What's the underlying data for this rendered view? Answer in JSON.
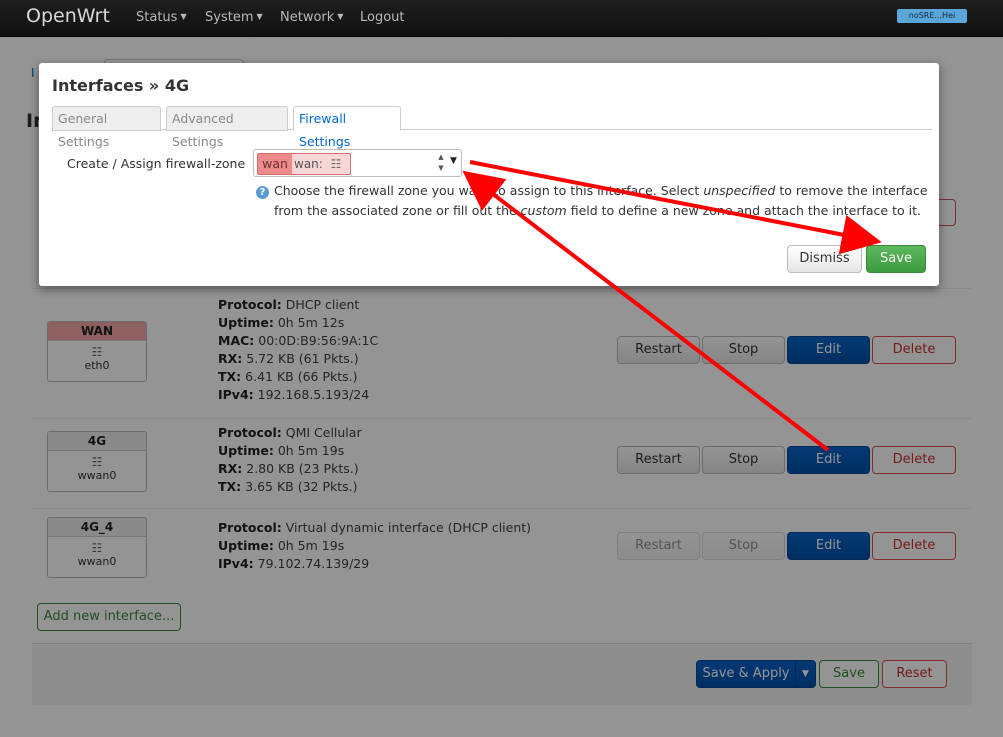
{
  "navbar": {
    "brand": "OpenWrt",
    "menu": [
      {
        "label": "Status",
        "caret": "▼"
      },
      {
        "label": "System",
        "caret": "▼"
      },
      {
        "label": "Network",
        "caret": "▼"
      },
      {
        "label": "Logout",
        "caret": ""
      }
    ],
    "host_badge": "noSRE...Hei"
  },
  "background": {
    "tab_peek": "I",
    "heading_peek": "In",
    "interfaces": [
      {
        "name": "WAN",
        "device": "eth0",
        "info": [
          {
            "key": "Protocol:",
            "value": " DHCP client"
          },
          {
            "key": "Uptime:",
            "value": " 0h 5m 12s"
          },
          {
            "key": "MAC:",
            "value": " 00:0D:B9:56:9A:1C"
          },
          {
            "key": "RX:",
            "value": " 5.72 KB (61 Pkts.)"
          },
          {
            "key": "TX:",
            "value": " 6.41 KB (66 Pkts.)"
          },
          {
            "key": "IPv4:",
            "value": " 192.168.5.193/24"
          }
        ]
      },
      {
        "name": "4G",
        "device": "wwan0",
        "info": [
          {
            "key": "Protocol:",
            "value": " QMI Cellular"
          },
          {
            "key": "Uptime:",
            "value": " 0h 5m 19s"
          },
          {
            "key": "RX:",
            "value": " 2.80 KB (23 Pkts.)"
          },
          {
            "key": "TX:",
            "value": " 3.65 KB (32 Pkts.)"
          }
        ]
      },
      {
        "name": "4G_4",
        "device": "wwan0",
        "info": [
          {
            "key": "Protocol:",
            "value": " Virtual dynamic interface (DHCP client)"
          },
          {
            "key": "Uptime:",
            "value": " 0h 5m 19s"
          },
          {
            "key": "IPv4:",
            "value": " 79.102.74.139/29"
          }
        ]
      }
    ],
    "row_buttons": {
      "restart": "Restart",
      "stop": "Stop",
      "edit": "Edit",
      "delete": "Delete"
    },
    "add_interface": "Add new interface...",
    "footer": {
      "save_apply": "Save & Apply",
      "save_apply_caret": "▼",
      "save": "Save",
      "reset": "Reset"
    }
  },
  "modal": {
    "title": "Interfaces » 4G",
    "tabs": [
      {
        "label": "General Settings",
        "active": false
      },
      {
        "label": "Advanced Settings",
        "active": false
      },
      {
        "label": "Firewall Settings",
        "active": true
      }
    ],
    "field": {
      "label": "Create / Assign firewall-zone",
      "zone_name": "wan",
      "zone_member": "wan:",
      "spin_up": "▲",
      "spin_down": "▼",
      "dropdown_arrow": "▼"
    },
    "help": {
      "icon": "?",
      "parts": [
        {
          "text": "Choose the firewall zone you want to assign to this interface. Select ",
          "style": "normal"
        },
        {
          "text": "unspecified",
          "style": "italic"
        },
        {
          "text": " to remove the interface from the associated zone or fill out the ",
          "style": "normal"
        },
        {
          "text": "custom",
          "style": "italic"
        },
        {
          "text": " field to define a new zone and attach the interface to it.",
          "style": "normal"
        }
      ]
    },
    "buttons": {
      "dismiss": "Dismiss",
      "save": "Save"
    }
  },
  "colors": {
    "arrow": "#ff0000",
    "wan_zone": "#f08a8a",
    "primary": "#0050a8",
    "success": "#4cae4c"
  },
  "icons": {
    "network_device": "network-port-icon",
    "help": "question-circle-icon"
  }
}
